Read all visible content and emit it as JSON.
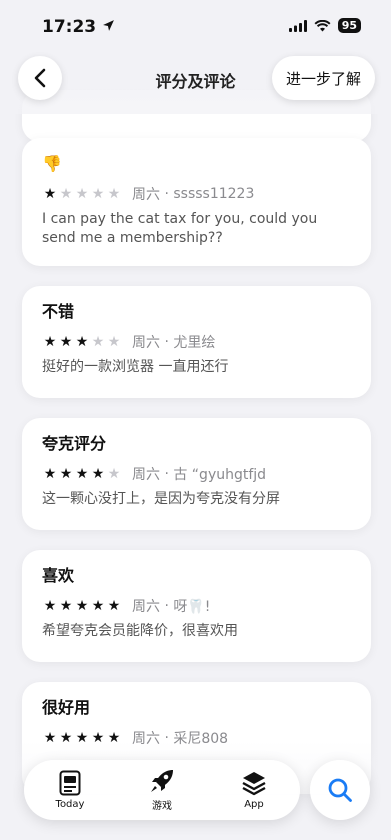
{
  "status_bar": {
    "time": "17:23",
    "battery": "95"
  },
  "nav": {
    "title": "评分及评论",
    "learn_more": "进一步了解"
  },
  "reviews": [
    {
      "title": "👎",
      "stars": 1,
      "day": "周六",
      "author": "sssss11223",
      "body": "I can pay the cat tax for you, could you send me a membership??"
    },
    {
      "title": "不错",
      "stars": 3,
      "day": "周六",
      "author": "尤里绘",
      "body": "挺好的一款浏览器 一直用还行"
    },
    {
      "title": "夸克评分",
      "stars": 4,
      "day": "周六",
      "author": "古 “gyuhgtfjd",
      "body": "这一颗心没打上，是因为夸克没有分屏"
    },
    {
      "title": "喜欢",
      "stars": 5,
      "day": "周六",
      "author": "呀🦷!",
      "body": "希望夸克会员能降价，很喜欢用"
    },
    {
      "title": "很好用",
      "stars": 5,
      "day": "周六",
      "author": "采尼808",
      "body": ""
    }
  ],
  "tabbar": {
    "today": "Today",
    "games": "游戏",
    "apps": "App"
  },
  "icons": {
    "back": "chevron-left-icon",
    "search": "search-icon",
    "location": "location-arrow-icon"
  },
  "colors": {
    "accent": "#1a7cf5",
    "star_on": "#111111",
    "star_off": "#c7c7cc"
  }
}
